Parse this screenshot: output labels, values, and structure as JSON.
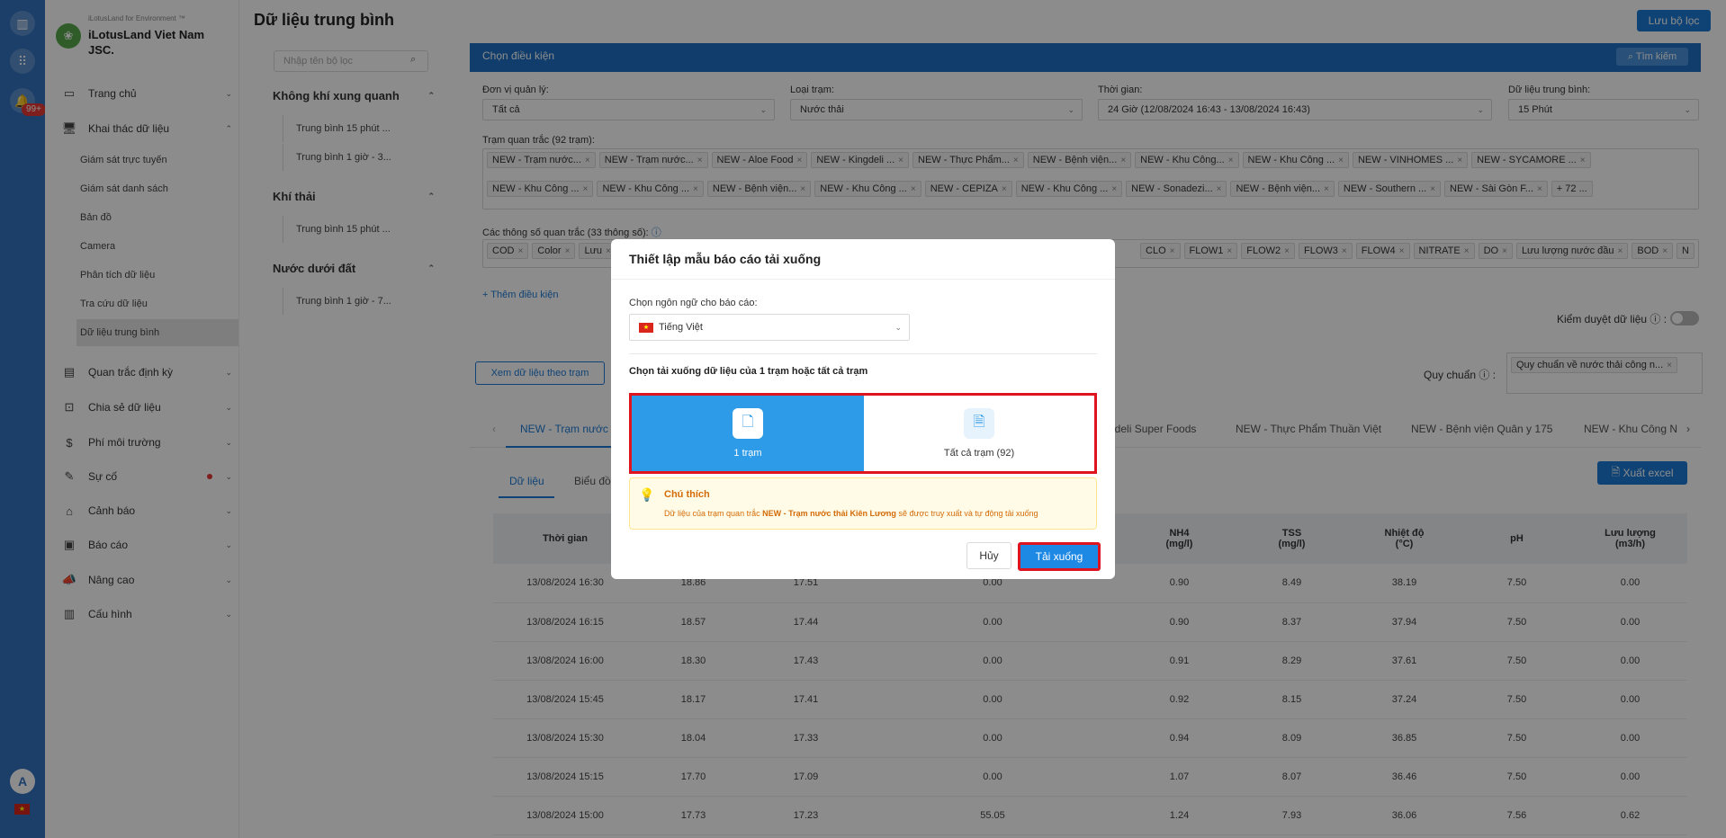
{
  "rail": {
    "badge": "99+",
    "avatar": "A"
  },
  "brand": {
    "tag": "iLotusLand for Environment ™",
    "name": "iLotusLand Viet Nam JSC."
  },
  "nav": {
    "home": "Trang chủ",
    "data_mining": "Khai thác dữ liệu",
    "sub": [
      "Giám sát trực tuyến",
      "Giám sát danh sách",
      "Bản đồ",
      "Camera",
      "Phân tích dữ liệu",
      "Tra cứu dữ liệu",
      "Dữ liệu trung bình"
    ],
    "periodic": "Quan trắc định kỳ",
    "share": "Chia sẻ dữ liệu",
    "fee": "Phí môi trường",
    "incident": "Sự cố",
    "alert": "Cảnh báo",
    "report": "Báo cáo",
    "advanced": "Nâng cao",
    "config": "Cấu hình"
  },
  "filters": {
    "search_placeholder": "Nhập tên bộ lọc",
    "groups": [
      {
        "name": "Không khí xung quanh",
        "items": [
          "Trung bình 15 phút ...",
          "Trung bình 1 giờ - 3..."
        ]
      },
      {
        "name": "Khí thải",
        "items": [
          "Trung bình 15 phút ..."
        ]
      },
      {
        "name": "Nước dưới đất",
        "items": [
          "Trung bình 1 giờ - 7..."
        ]
      }
    ]
  },
  "page": {
    "title": "Dữ liệu trung bình",
    "save_filter": "Lưu bộ lọc"
  },
  "conditions": {
    "header": "Chọn điều kiện",
    "search_btn": "Tìm kiếm",
    "unit_label": "Đơn vị quản lý:",
    "unit_value": "Tất cả",
    "station_type_label": "Loại trạm:",
    "station_type_value": "Nước thải",
    "time_label": "Thời gian:",
    "time_value": "24 Giờ (12/08/2024 16:43 - 13/08/2024 16:43)",
    "avg_label": "Dữ liệu trung bình:",
    "avg_value": "15 Phút",
    "stations_label": "Trạm quan trắc (92 trạm):",
    "stations": [
      "NEW - Trạm nước...",
      "NEW - Trạm nước...",
      "NEW - Aloe Food",
      "NEW - Kingdeli ...",
      "NEW - Thực Phẩm...",
      "NEW - Bệnh viện...",
      "NEW - Khu Công...",
      "NEW - Khu Công ...",
      "NEW - VINHOMES ...",
      "NEW - SYCAMORE ...",
      "NEW - Khu Công ...",
      "NEW - Khu Công ...",
      "NEW - Bệnh viện...",
      "NEW - Khu Công ...",
      "NEW - CEPIZA",
      "NEW - Khu Công ...",
      "NEW - Sonadezi...",
      "NEW - Bệnh viện...",
      "NEW - Southern ...",
      "NEW - Sài Gòn F..."
    ],
    "stations_more": "+ 72 ...",
    "params_label": "Các thông số quan trắc (33 thông số):",
    "params_left": [
      "COD",
      "Color",
      "Lưu"
    ],
    "params_right": [
      "CLO",
      "FLOW1",
      "FLOW2",
      "FLOW3",
      "FLOW4",
      "NITRATE",
      "DO",
      "Lưu lượng nước đầu",
      "BOD",
      "N"
    ],
    "add_condition": "+ Thêm điều kiện",
    "data_check": "Kiểm duyệt dữ liệu",
    "view_by_station": "Xem dữ liệu theo trạm",
    "standard_label": "Quy chuẩn",
    "standard_value": "Quy chuẩn về nước thải công n..."
  },
  "station_tabs": [
    "NEW - Trạm nước",
    "gdeli Super Foods",
    "NEW - Thực Phẩm Thuần Việt",
    "NEW - Bệnh viện Quân y 175",
    "NEW - Khu Công N"
  ],
  "view_tabs": {
    "data": "Dữ liệu",
    "chart": "Biểu đồ"
  },
  "export_excel": "Xuất excel",
  "table": {
    "headers": {
      "time": "Thời gian",
      "nh4": "NH4\n(mg/l)",
      "tss": "TSS\n(mg/l)",
      "temp": "Nhiệt độ\n(°C)",
      "ph": "pH",
      "flow": "Lưu lượng\n(m3/h)"
    },
    "rows": [
      [
        "13/08/2024 16:30",
        "18.86",
        "17.51",
        "0.00",
        "0.90",
        "8.49",
        "38.19",
        "7.50",
        "0.00"
      ],
      [
        "13/08/2024 16:15",
        "18.57",
        "17.44",
        "0.00",
        "0.90",
        "8.37",
        "37.94",
        "7.50",
        "0.00"
      ],
      [
        "13/08/2024 16:00",
        "18.30",
        "17.43",
        "0.00",
        "0.91",
        "8.29",
        "37.61",
        "7.50",
        "0.00"
      ],
      [
        "13/08/2024 15:45",
        "18.17",
        "17.41",
        "0.00",
        "0.92",
        "8.15",
        "37.24",
        "7.50",
        "0.00"
      ],
      [
        "13/08/2024 15:30",
        "18.04",
        "17.33",
        "0.00",
        "0.94",
        "8.09",
        "36.85",
        "7.50",
        "0.00"
      ],
      [
        "13/08/2024 15:15",
        "17.70",
        "17.09",
        "0.00",
        "1.07",
        "8.07",
        "36.46",
        "7.50",
        "0.00"
      ],
      [
        "13/08/2024 15:00",
        "17.73",
        "17.23",
        "55.05",
        "1.24",
        "7.93",
        "36.06",
        "7.56",
        "0.62"
      ]
    ]
  },
  "modal": {
    "title": "Thiết lập mẫu báo cáo tải xuống",
    "lang_label": "Chọn ngôn ngữ cho báo cáo:",
    "lang_value": "Tiếng Việt",
    "scope_label": "Chọn tải xuống dữ liệu của 1 trạm hoặc tất cả trạm",
    "opt_one": "1 trạm",
    "opt_all": "Tất cả trạm (92)",
    "note_title": "Chú thích",
    "note_pre": "Dữ liệu của trạm quan trắc",
    "note_station": "NEW - Trạm nước thải Kiên Lương",
    "note_post": "sẽ được truy xuất và tự động tải xuống",
    "cancel": "Hủy",
    "download": "Tải xuống"
  },
  "colors": {
    "primary": "#1e7ad6",
    "selected_option": "#2d9be8",
    "highlight": "#e0141e"
  }
}
